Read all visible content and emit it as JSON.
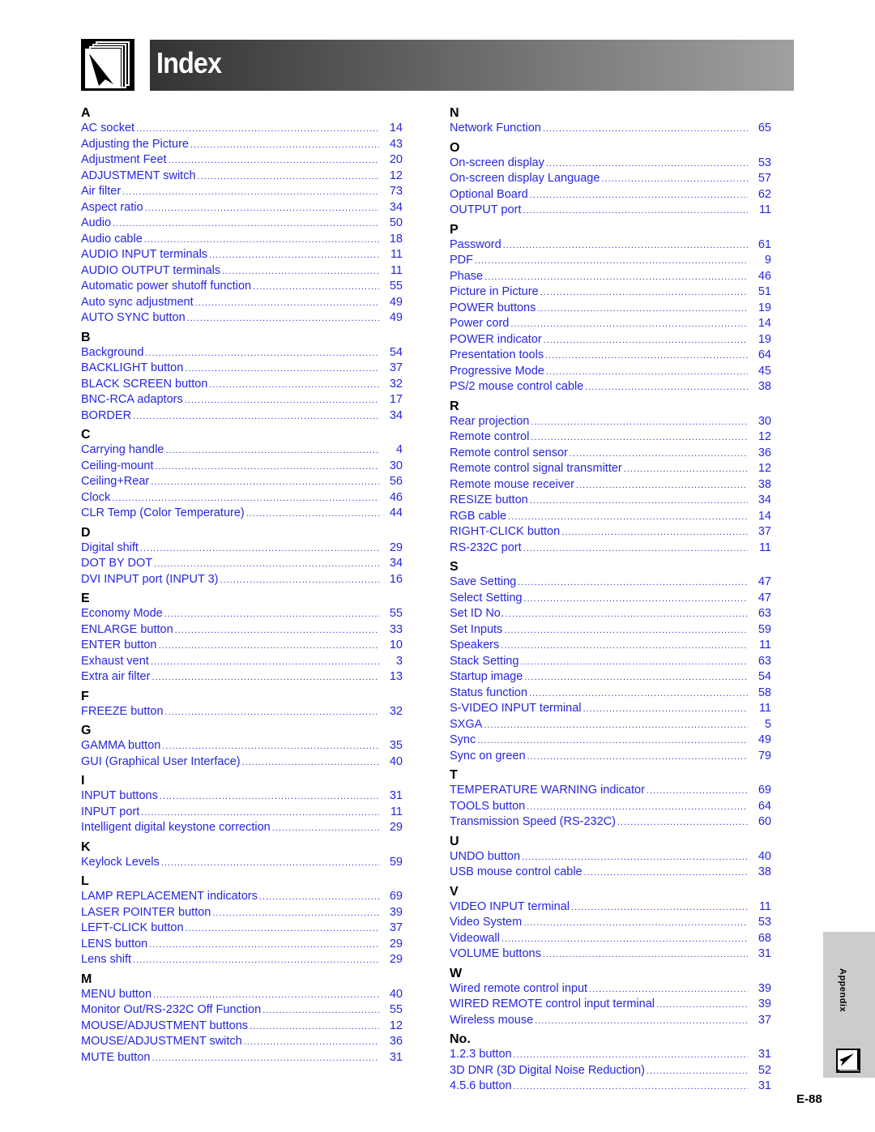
{
  "header": {
    "title": "Index",
    "icon": "book-pointer-icon"
  },
  "side_tab": {
    "label": "Appendix",
    "icon": "book-pointer-icon"
  },
  "page_number": "E-88",
  "colors": {
    "entry_text": "#2626e0",
    "heading_text": "#000000",
    "tab_bg": "#cccccc"
  },
  "columns": [
    {
      "sections": [
        {
          "letter": "A",
          "entries": [
            {
              "label": "AC socket",
              "page": "14"
            },
            {
              "label": "Adjusting the Picture",
              "page": "43"
            },
            {
              "label": "Adjustment Feet",
              "page": "20"
            },
            {
              "label": "ADJUSTMENT switch",
              "page": "12"
            },
            {
              "label": "Air filter",
              "page": "73"
            },
            {
              "label": "Aspect ratio",
              "page": "34"
            },
            {
              "label": "Audio",
              "page": "50"
            },
            {
              "label": "Audio cable",
              "page": "18"
            },
            {
              "label": "AUDIO INPUT terminals",
              "page": "11"
            },
            {
              "label": "AUDIO OUTPUT terminals",
              "page": "11"
            },
            {
              "label": "Automatic power shutoff function",
              "page": "55"
            },
            {
              "label": "Auto sync adjustment",
              "page": "49"
            },
            {
              "label": "AUTO SYNC button",
              "page": "49"
            }
          ]
        },
        {
          "letter": "B",
          "entries": [
            {
              "label": "Background",
              "page": "54"
            },
            {
              "label": "BACKLIGHT button",
              "page": "37"
            },
            {
              "label": "BLACK SCREEN button",
              "page": "32"
            },
            {
              "label": "BNC-RCA adaptors",
              "page": "17"
            },
            {
              "label": "BORDER",
              "page": "34"
            }
          ]
        },
        {
          "letter": "C",
          "entries": [
            {
              "label": "Carrying handle",
              "page": "4"
            },
            {
              "label": "Ceiling-mount",
              "page": "30"
            },
            {
              "label": "Ceiling+Rear",
              "page": "56"
            },
            {
              "label": "Clock",
              "page": "46"
            },
            {
              "label": "CLR Temp (Color Temperature)",
              "page": "44"
            }
          ]
        },
        {
          "letter": "D",
          "entries": [
            {
              "label": "Digital shift",
              "page": "29"
            },
            {
              "label": "DOT BY DOT",
              "page": "34"
            },
            {
              "label": "DVI INPUT port (INPUT 3)",
              "page": "16"
            }
          ]
        },
        {
          "letter": "E",
          "entries": [
            {
              "label": "Economy Mode",
              "page": "55"
            },
            {
              "label": "ENLARGE button",
              "page": "33"
            },
            {
              "label": "ENTER button",
              "page": "10"
            },
            {
              "label": "Exhaust vent",
              "page": "3"
            },
            {
              "label": "Extra air filter",
              "page": "13"
            }
          ]
        },
        {
          "letter": "F",
          "entries": [
            {
              "label": "FREEZE button",
              "page": "32"
            }
          ]
        },
        {
          "letter": "G",
          "entries": [
            {
              "label": "GAMMA button",
              "page": "35"
            },
            {
              "label": "GUI (Graphical User Interface)",
              "page": "40"
            }
          ]
        },
        {
          "letter": "I",
          "entries": [
            {
              "label": "INPUT buttons",
              "page": "31"
            },
            {
              "label": "INPUT port",
              "page": "11"
            },
            {
              "label": "Intelligent digital keystone correction",
              "page": "29"
            }
          ]
        },
        {
          "letter": "K",
          "entries": [
            {
              "label": "Keylock Levels",
              "page": "59"
            }
          ]
        },
        {
          "letter": "L",
          "entries": [
            {
              "label": "LAMP REPLACEMENT indicators",
              "page": "69"
            },
            {
              "label": "LASER POINTER button",
              "page": "39"
            },
            {
              "label": "LEFT-CLICK button",
              "page": "37"
            },
            {
              "label": "LENS button",
              "page": "29"
            },
            {
              "label": "Lens shift",
              "page": "29"
            }
          ]
        },
        {
          "letter": "M",
          "entries": [
            {
              "label": "MENU button",
              "page": "40"
            },
            {
              "label": "Monitor Out/RS-232C Off Function",
              "page": "55"
            },
            {
              "label": "MOUSE/ADJUSTMENT buttons",
              "page": "12"
            },
            {
              "label": "MOUSE/ADJUSTMENT switch",
              "page": "36"
            },
            {
              "label": "MUTE button",
              "page": "31"
            }
          ]
        }
      ]
    },
    {
      "sections": [
        {
          "letter": "N",
          "entries": [
            {
              "label": "Network Function",
              "page": "65"
            }
          ]
        },
        {
          "letter": "O",
          "entries": [
            {
              "label": "On-screen display",
              "page": "53"
            },
            {
              "label": "On-screen display Language",
              "page": "57"
            },
            {
              "label": "Optional Board",
              "page": "62"
            },
            {
              "label": "OUTPUT port",
              "page": "11"
            }
          ]
        },
        {
          "letter": "P",
          "entries": [
            {
              "label": "Password",
              "page": "61"
            },
            {
              "label": "PDF",
              "page": "9"
            },
            {
              "label": "Phase",
              "page": "46"
            },
            {
              "label": "Picture in Picture",
              "page": "51"
            },
            {
              "label": "POWER buttons",
              "page": "19"
            },
            {
              "label": "Power cord",
              "page": "14"
            },
            {
              "label": "POWER indicator",
              "page": "19"
            },
            {
              "label": "Presentation tools",
              "page": "64"
            },
            {
              "label": "Progressive Mode",
              "page": "45"
            },
            {
              "label": "PS/2 mouse control cable",
              "page": "38"
            }
          ]
        },
        {
          "letter": "R",
          "entries": [
            {
              "label": "Rear projection",
              "page": "30"
            },
            {
              "label": "Remote control",
              "page": "12"
            },
            {
              "label": "Remote control sensor",
              "page": "36"
            },
            {
              "label": "Remote control signal transmitter",
              "page": "12"
            },
            {
              "label": "Remote mouse receiver",
              "page": "38"
            },
            {
              "label": "RESIZE button",
              "page": "34"
            },
            {
              "label": "RGB cable",
              "page": "14"
            },
            {
              "label": "RIGHT-CLICK button",
              "page": "37"
            },
            {
              "label": "RS-232C port",
              "page": "11"
            }
          ]
        },
        {
          "letter": "S",
          "entries": [
            {
              "label": "Save Setting",
              "page": "47"
            },
            {
              "label": "Select Setting",
              "page": "47"
            },
            {
              "label": "Set ID No.",
              "page": "63"
            },
            {
              "label": "Set Inputs",
              "page": "59"
            },
            {
              "label": "Speakers",
              "page": "11"
            },
            {
              "label": "Stack Setting",
              "page": "63"
            },
            {
              "label": "Startup image",
              "page": "54"
            },
            {
              "label": "Status function",
              "page": "58"
            },
            {
              "label": "S-VIDEO INPUT terminal",
              "page": "11"
            },
            {
              "label": "SXGA",
              "page": "5"
            },
            {
              "label": "Sync",
              "page": "49"
            },
            {
              "label": "Sync on green",
              "page": "79"
            }
          ]
        },
        {
          "letter": "T",
          "entries": [
            {
              "label": "TEMPERATURE WARNING indicator",
              "page": "69"
            },
            {
              "label": "TOOLS button",
              "page": "64"
            },
            {
              "label": "Transmission Speed (RS-232C)",
              "page": "60"
            }
          ]
        },
        {
          "letter": "U",
          "entries": [
            {
              "label": "UNDO button",
              "page": "40"
            },
            {
              "label": "USB mouse control cable",
              "page": "38"
            }
          ]
        },
        {
          "letter": "V",
          "entries": [
            {
              "label": "VIDEO INPUT terminal",
              "page": "11"
            },
            {
              "label": "Video System",
              "page": "53"
            },
            {
              "label": "Videowall",
              "page": "68"
            },
            {
              "label": "VOLUME buttons",
              "page": "31"
            }
          ]
        },
        {
          "letter": "W",
          "entries": [
            {
              "label": "Wired remote control input",
              "page": "39"
            },
            {
              "label": "WIRED REMOTE control input terminal",
              "page": "39"
            },
            {
              "label": "Wireless mouse",
              "page": "37"
            }
          ]
        },
        {
          "letter": "No.",
          "entries": [
            {
              "label": "1.2.3 button",
              "page": "31"
            },
            {
              "label": "3D DNR (3D Digital Noise Reduction)",
              "page": "52"
            },
            {
              "label": "4.5.6 button",
              "page": "31"
            }
          ]
        }
      ]
    }
  ]
}
